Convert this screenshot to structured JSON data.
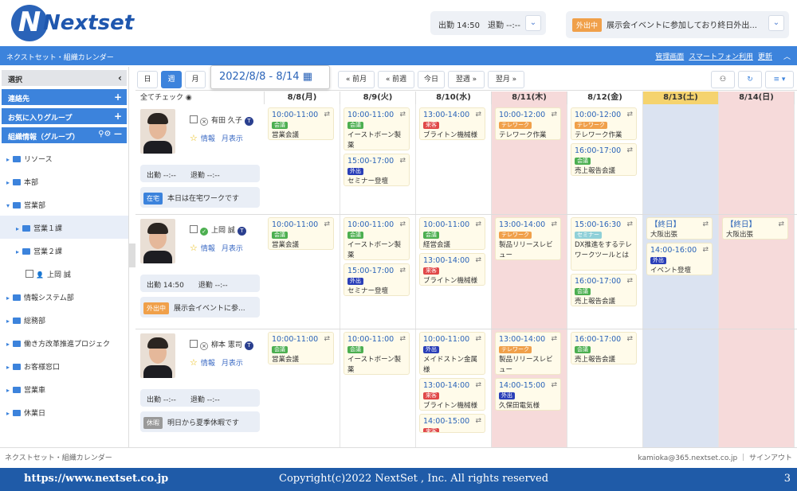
{
  "brand": {
    "logo": "Nextset"
  },
  "header": {
    "attendance": "出勤 14:50　退勤 --:--",
    "status_label": "外出中",
    "status_text": "展示会イベントに参加しており終日外出...",
    "dropdown": "⌄"
  },
  "bar": {
    "title": "ネクストセット・組織カレンダー",
    "links": [
      "管理画面",
      "スマートフォン利用",
      "更新"
    ]
  },
  "sidebar": {
    "select": "選択",
    "contacts": "連絡先",
    "favorites": "お気に入りグループ",
    "org": "組織情報（グループ）",
    "items": [
      {
        "label": "リソース",
        "level": 0
      },
      {
        "label": "本部",
        "level": 0
      },
      {
        "label": "営業部",
        "level": 0,
        "open": true
      },
      {
        "label": "営業１課",
        "level": 1
      },
      {
        "label": "営業２課",
        "level": 1
      },
      {
        "label": "上岡 誠",
        "level": 2,
        "user": true
      },
      {
        "label": "情報システム部",
        "level": 0
      },
      {
        "label": "総務部",
        "level": 0
      },
      {
        "label": "働き方改革推進プロジェク",
        "level": 0
      },
      {
        "label": "お客様窓口",
        "level": 0
      },
      {
        "label": "営業車",
        "level": 0
      },
      {
        "label": "休業日",
        "level": 0
      }
    ]
  },
  "toolbar": {
    "day": "日",
    "week": "週",
    "month": "月",
    "range": "2022/8/8 - 8/14",
    "prev_month": "« 前月",
    "prev_week": "« 前週",
    "today": "今日",
    "next_week": "翌週 »",
    "next_month": "翌月 »",
    "check_all": "全てチェック"
  },
  "days": [
    {
      "label": "8/8(月)",
      "bg": "#ffffff"
    },
    {
      "label": "8/9(火)",
      "bg": "#ffffff"
    },
    {
      "label": "8/10(水)",
      "bg": "#ffffff"
    },
    {
      "label": "8/11(木)",
      "bg": "#f6dada"
    },
    {
      "label": "8/12(金)",
      "bg": "#ffffff"
    },
    {
      "label": "8/13(土)",
      "bg": "#dbe3f1"
    },
    {
      "label": "8/14(日)",
      "bg": "#f6dada"
    }
  ],
  "people": [
    {
      "name": "有田 久子",
      "info": "情報",
      "month": "月表示",
      "attendance": "出勤 --:--　　退勤 --:--",
      "status_label": "在宅",
      "status_color": "#3c83dc",
      "status_text": "本日は在宅ワークです"
    },
    {
      "name": "上岡 誠",
      "info": "情報",
      "month": "月表示",
      "attendance": "出勤 14:50　　退勤 --:--",
      "status_label": "外出中",
      "status_color": "#f0a04a",
      "status_text": "展示会イベントに参..."
    },
    {
      "name": "柳本 憲司",
      "info": "情報",
      "month": "月表示",
      "attendance": "出勤 --:--　　退勤 --:--",
      "status_label": "休暇",
      "status_color": "#999999",
      "status_text": "明日から夏季休暇です"
    }
  ],
  "events": [
    {
      "row": 0,
      "day": 0,
      "slot": 0,
      "time": "10:00-11:00",
      "tag": "会議",
      "tagc": "#4caf50",
      "title": "営業会議",
      "lines": 1
    },
    {
      "row": 0,
      "day": 1,
      "slot": 0,
      "time": "10:00-11:00",
      "tag": "会議",
      "tagc": "#4caf50",
      "title": "イーストボーン製薬",
      "lines": 2
    },
    {
      "row": 0,
      "day": 1,
      "slot": 1,
      "time": "15:00-17:00",
      "tag": "外出",
      "tagc": "#2a3fb8",
      "title": "セミナー登壇",
      "lines": 1
    },
    {
      "row": 0,
      "day": 2,
      "slot": 0,
      "time": "13:00-14:00",
      "tag": "来客",
      "tagc": "#e04848",
      "title": "ブライトン機械様",
      "lines": 1
    },
    {
      "row": 0,
      "day": 3,
      "slot": 0,
      "time": "10:00-12:00",
      "tag": "テレワーク",
      "tagc": "#f0a04a",
      "title": "テレワーク作業",
      "lines": 1
    },
    {
      "row": 0,
      "day": 4,
      "slot": 0,
      "time": "10:00-12:00",
      "tag": "テレワーク",
      "tagc": "#f0a04a",
      "title": "テレワーク作業",
      "lines": 1
    },
    {
      "row": 0,
      "day": 4,
      "slot": 1,
      "time": "16:00-17:00",
      "tag": "会議",
      "tagc": "#4caf50",
      "title": "売上報告会議",
      "lines": 1
    },
    {
      "row": 1,
      "day": 0,
      "slot": 0,
      "time": "10:00-11:00",
      "tag": "会議",
      "tagc": "#4caf50",
      "title": "営業会議",
      "lines": 1
    },
    {
      "row": 1,
      "day": 1,
      "slot": 0,
      "time": "10:00-11:00",
      "tag": "会議",
      "tagc": "#4caf50",
      "title": "イーストボーン製薬",
      "lines": 2
    },
    {
      "row": 1,
      "day": 1,
      "slot": 1,
      "time": "15:00-17:00",
      "tag": "外出",
      "tagc": "#2a3fb8",
      "title": "セミナー登壇",
      "lines": 1
    },
    {
      "row": 1,
      "day": 2,
      "slot": 0,
      "time": "10:00-11:00",
      "tag": "会議",
      "tagc": "#4caf50",
      "title": "経営会議",
      "lines": 1
    },
    {
      "row": 1,
      "day": 2,
      "slot": 1,
      "time": "13:00-14:00",
      "tag": "来客",
      "tagc": "#e04848",
      "title": "ブライトン機械様",
      "lines": 1
    },
    {
      "row": 1,
      "day": 3,
      "slot": 0,
      "time": "13:00-14:00",
      "tag": "テレワーク",
      "tagc": "#f0a04a",
      "title": "製品リリースレビュー",
      "lines": 2
    },
    {
      "row": 1,
      "day": 4,
      "slot": 0,
      "time": "15:00-16:30",
      "tag": "セミナー",
      "tagc": "#8fd0d8",
      "title": "DX推進をするテレワークツールとは",
      "lines": 3
    },
    {
      "row": 1,
      "day": 4,
      "slot": 2,
      "time": "16:00-17:00",
      "tag": "会議",
      "tagc": "#4caf50",
      "title": "売上報告会議",
      "lines": 1
    },
    {
      "row": 1,
      "day": 5,
      "slot": 0,
      "time": "【終日】",
      "tag": "",
      "tagc": "",
      "title": "大阪出張",
      "lines": 1,
      "short": true
    },
    {
      "row": 1,
      "day": 5,
      "slot": 1,
      "time": "14:00-16:00",
      "tag": "外出",
      "tagc": "#2a3fb8",
      "title": "イベント登壇",
      "lines": 1
    },
    {
      "row": 1,
      "day": 6,
      "slot": 0,
      "time": "【終日】",
      "tag": "",
      "tagc": "",
      "title": "大阪出張",
      "lines": 1,
      "short": true
    },
    {
      "row": 2,
      "day": 0,
      "slot": 0,
      "time": "10:00-11:00",
      "tag": "会議",
      "tagc": "#4caf50",
      "title": "営業会議",
      "lines": 1
    },
    {
      "row": 2,
      "day": 1,
      "slot": 0,
      "time": "10:00-11:00",
      "tag": "会議",
      "tagc": "#4caf50",
      "title": "イーストボーン製薬",
      "lines": 2
    },
    {
      "row": 2,
      "day": 2,
      "slot": 0,
      "time": "10:00-11:00",
      "tag": "外出",
      "tagc": "#2a3fb8",
      "title": "メイドストン金属様",
      "lines": 2
    },
    {
      "row": 2,
      "day": 2,
      "slot": 1,
      "time": "13:00-14:00",
      "tag": "来客",
      "tagc": "#e04848",
      "title": "ブライトン機械様",
      "lines": 1
    },
    {
      "row": 2,
      "day": 2,
      "slot": 2,
      "time": "14:00-15:00",
      "tag": "来客",
      "tagc": "#e04848",
      "title": "",
      "lines": 0
    },
    {
      "row": 2,
      "day": 3,
      "slot": 0,
      "time": "13:00-14:00",
      "tag": "テレワーク",
      "tagc": "#f0a04a",
      "title": "製品リリースレビュー",
      "lines": 2
    },
    {
      "row": 2,
      "day": 3,
      "slot": 1,
      "time": "14:00-15:00",
      "tag": "外出",
      "tagc": "#2a3fb8",
      "title": "久保田電気様",
      "lines": 1
    },
    {
      "row": 2,
      "day": 4,
      "slot": 0,
      "time": "16:00-17:00",
      "tag": "会議",
      "tagc": "#4caf50",
      "title": "売上報告会議",
      "lines": 1
    }
  ],
  "footer": {
    "left": "ネクストセット・組織カレンダー",
    "right": "kamioka@365.nextset.co.jp ｜ サインアウト"
  },
  "slide": {
    "url": "https://www.nextset.co.jp",
    "copyright": "Copyright(c)2022 NextSet , Inc. All rights reserved",
    "page": "3"
  }
}
